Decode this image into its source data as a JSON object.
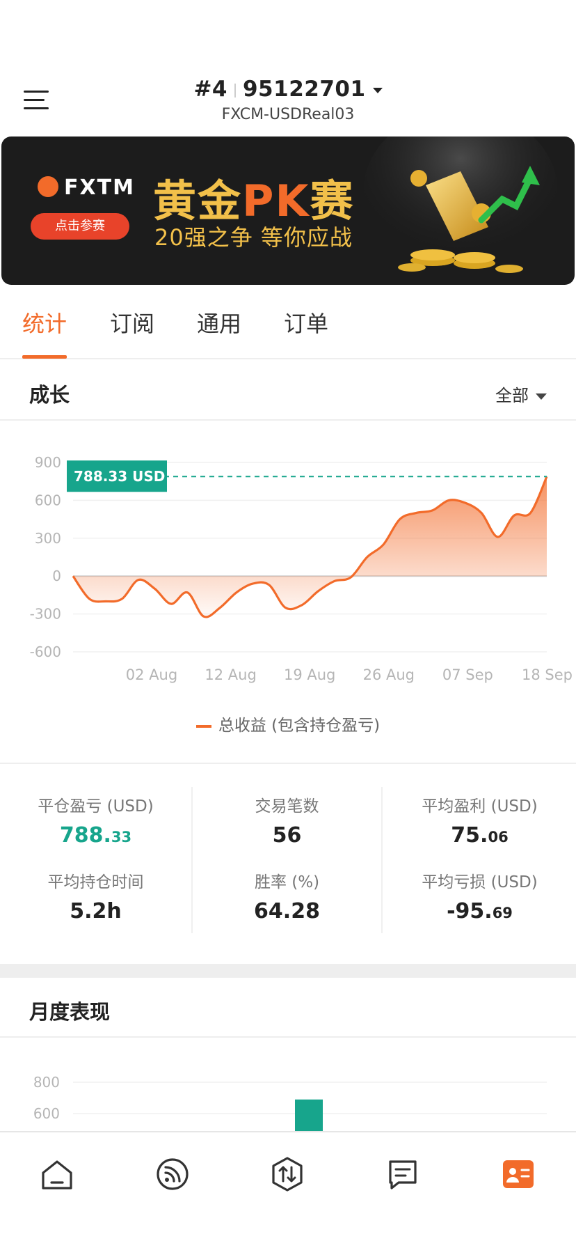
{
  "header": {
    "account_rank": "#4",
    "account_number": "95122701",
    "server": "FXCM-USDReal03"
  },
  "banner": {
    "brand": "FXTM",
    "button_label": "点击参赛",
    "title_prefix": "黄金",
    "title_pk": "PK",
    "title_suffix": "赛",
    "subtitle": "20强之争  等你应战"
  },
  "tabs": [
    {
      "label": "统计",
      "active": true
    },
    {
      "label": "订阅",
      "active": false
    },
    {
      "label": "通用",
      "active": false
    },
    {
      "label": "订单",
      "active": false
    }
  ],
  "growth": {
    "title": "成长",
    "filter_label": "全部",
    "badge": "788.33 USD",
    "legend": "总收益 (包含持仓盈亏)"
  },
  "chart_data": [
    {
      "type": "area",
      "title": "",
      "xlabel": "",
      "ylabel": "",
      "ylim": [
        -600,
        900
      ],
      "yticks": [
        900,
        600,
        300,
        0,
        -300,
        -600
      ],
      "xtick_labels": [
        "02 Aug",
        "12 Aug",
        "19 Aug",
        "26 Aug",
        "07 Sep",
        "18 Sep"
      ],
      "last_value": 788.33,
      "series": [
        {
          "name": "总收益 (包含持仓盈亏)",
          "values": [
            0,
            -180,
            -200,
            -180,
            -30,
            -100,
            -220,
            -130,
            -320,
            -250,
            -130,
            -60,
            -70,
            -250,
            -230,
            -120,
            -40,
            -10,
            150,
            250,
            450,
            500,
            520,
            600,
            580,
            500,
            310,
            480,
            500,
            788.33
          ]
        }
      ]
    },
    {
      "type": "bar",
      "title": "",
      "ylim": [
        600,
        800
      ],
      "yticks": [
        800,
        600
      ],
      "categories": [
        ""
      ],
      "values": [
        690
      ]
    }
  ],
  "stats": {
    "closed_pnl_label": "平仓盈亏 (USD)",
    "closed_pnl_int": "788.",
    "closed_pnl_dec": "33",
    "trades_label": "交易笔数",
    "trades_value": "56",
    "avg_profit_label": "平均盈利 (USD)",
    "avg_profit_int": "75.",
    "avg_profit_dec": "06",
    "avg_hold_label": "平均持仓时间",
    "avg_hold_value": "5.2h",
    "win_rate_label": "胜率 (%)",
    "win_rate_value": "64.28",
    "avg_loss_label": "平均亏损 (USD)",
    "avg_loss_int": "-95.",
    "avg_loss_dec": "69"
  },
  "monthly": {
    "title": "月度表现"
  },
  "colors": {
    "accent": "#f26b2a",
    "positive": "#17a58c",
    "banner_bg": "#1c1c1c",
    "gold": "#f2c04a"
  },
  "nav": [
    "home-icon",
    "feed-icon",
    "trade-icon",
    "messages-icon",
    "profile-icon"
  ]
}
